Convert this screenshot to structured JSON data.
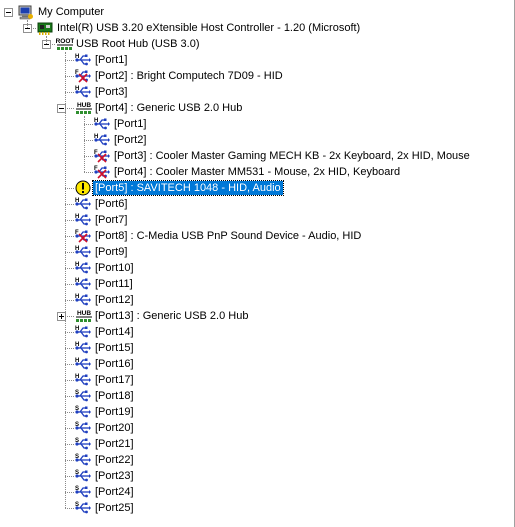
{
  "tree": {
    "root": {
      "label": "My Computer",
      "icon": "computer-icon",
      "expanded": true
    },
    "controller": {
      "label": "Intel(R) USB 3.20 eXtensible Host Controller - 1.20 (Microsoft)",
      "icon": "pci-controller-icon",
      "expanded": true
    },
    "hub": {
      "label": "USB Root Hub (USB 3.0)",
      "icon": "root-hub-icon",
      "icon_text": "ROOT",
      "expanded": true
    },
    "port4_children": [
      {
        "label": "[Port1]",
        "icon": "usb-port-icon"
      },
      {
        "label": "[Port2]",
        "icon": "usb-port-icon"
      },
      {
        "label": "[Port3] : Cooler Master Gaming MECH KB - 2x Keyboard, 2x HID, Mouse",
        "icon": "usb-device-icon"
      },
      {
        "label": "[Port4] : Cooler Master MM531 - Mouse, 2x HID, Keyboard",
        "icon": "usb-device-icon"
      }
    ],
    "ports": [
      {
        "label": "[Port1]",
        "icon": "usb-port-icon"
      },
      {
        "label": "[Port2] : Bright Computech 7D09 - HID",
        "icon": "usb-device-icon"
      },
      {
        "label": "[Port3]",
        "icon": "usb-port-icon"
      },
      {
        "label": "[Port4] : Generic USB 2.0 Hub",
        "icon": "usb-hub-icon",
        "expanded": true
      },
      {
        "label": "[Port5] : SAVITECH 1048 - HID, Audio",
        "icon": "warning-icon",
        "selected": true
      },
      {
        "label": "[Port6]",
        "icon": "usb-port-icon"
      },
      {
        "label": "[Port7]",
        "icon": "usb-port-icon"
      },
      {
        "label": "[Port8] : C-Media USB PnP Sound Device - Audio, HID",
        "icon": "usb-device-icon"
      },
      {
        "label": "[Port9]",
        "icon": "usb-port-icon"
      },
      {
        "label": "[Port10]",
        "icon": "usb-port-icon"
      },
      {
        "label": "[Port11]",
        "icon": "usb-port-icon"
      },
      {
        "label": "[Port12]",
        "icon": "usb-port-icon"
      },
      {
        "label": "[Port13] : Generic USB 2.0 Hub",
        "icon": "usb-hub-icon",
        "expanded": false
      },
      {
        "label": "[Port14]",
        "icon": "usb-port-icon"
      },
      {
        "label": "[Port15]",
        "icon": "usb-port-icon"
      },
      {
        "label": "[Port16]",
        "icon": "usb-port-icon"
      },
      {
        "label": "[Port17]",
        "icon": "usb-port-icon"
      },
      {
        "label": "[Port18]",
        "icon": "usb-ss-port-icon"
      },
      {
        "label": "[Port19]",
        "icon": "usb-ss-port-icon"
      },
      {
        "label": "[Port20]",
        "icon": "usb-ss-port-icon"
      },
      {
        "label": "[Port21]",
        "icon": "usb-ss-port-icon"
      },
      {
        "label": "[Port22]",
        "icon": "usb-ss-port-icon"
      },
      {
        "label": "[Port23]",
        "icon": "usb-ss-port-icon"
      },
      {
        "label": "[Port24]",
        "icon": "usb-ss-port-icon"
      },
      {
        "label": "[Port25]",
        "icon": "usb-ss-port-icon"
      }
    ],
    "hub_icon_text": "HUB",
    "colors": {
      "selection": "#0078d7",
      "usb_blue": "#1f3fbf",
      "device_red": "#d0102a",
      "warning_yellow": "#ffe800",
      "connector": "#8a8a8a"
    }
  }
}
